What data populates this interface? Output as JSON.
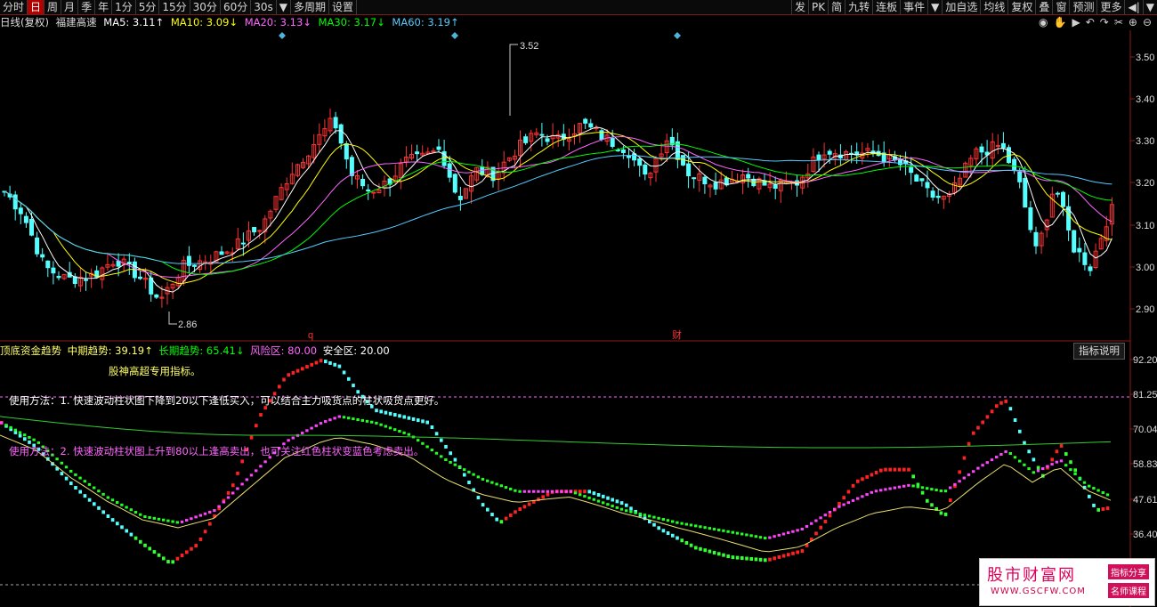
{
  "toolbar": {
    "left": [
      "分时",
      "日",
      "周",
      "月",
      "季",
      "年",
      "1分",
      "5分",
      "15分",
      "30分",
      "60分",
      "30s",
      "▼",
      "多周期",
      "设置"
    ],
    "active_index": 1,
    "right": [
      "发",
      "PK",
      "简",
      "九转",
      "连板",
      "事件",
      "▼",
      "加自选",
      "均线",
      "复权",
      "叠",
      "窗",
      "预测",
      "更多",
      "◀|",
      "▼"
    ]
  },
  "header": {
    "period": "日线(复权)",
    "stock": "福建高速",
    "ma5": "MA5: 3.11↑",
    "ma10": "MA10: 3.09↓",
    "ma20": "MA20: 3.13↓",
    "ma30": "MA30: 3.17↓",
    "ma60": "MA60: 3.19↑"
  },
  "colors": {
    "ma5": "#ffffff",
    "ma10": "#ffff00",
    "ma20": "#ff66ff",
    "ma30": "#00ff00",
    "ma60": "#55ccff",
    "up": "#ff3333",
    "down": "#55ffff"
  },
  "right_icons": [
    "eye-icon",
    "hand-icon",
    "play-icon",
    "undo-icon",
    "redo-icon",
    "scissors-icon",
    "plus-icon",
    "minus-icon"
  ],
  "price_axis": [
    "3.50",
    "3.40",
    "3.30",
    "3.20",
    "3.10",
    "3.00",
    "2.90"
  ],
  "price_annotations": {
    "high": "3.52",
    "low": "2.86"
  },
  "markers": {
    "q": "q",
    "cai": "财"
  },
  "indicator": {
    "name": "顶底资金趋势",
    "mid": "中期趋势: 39.19↑",
    "long": "长期趋势: 65.41↓",
    "risk": "风险区: 80.00",
    "safe": "安全区: 20.00",
    "explain_button": "指标说明",
    "note1": "股神高超专用指标。",
    "note2": "使用方法：1. 快速波动柱状图下降到20以下逢低买入，可以结合主力吸货点的柱状吸货点更好。",
    "note3": "使用方法：2. 快速波动柱状图上升到80以上逢高卖出，也可关注红色柱状变蓝色考虑卖出。"
  },
  "indicator_axis": [
    "92.20",
    "81.25",
    "70.04",
    "58.83",
    "47.61",
    "36.40"
  ],
  "watermark": {
    "title": "股市财富网",
    "url": "WWW.GSCFW.COM",
    "tag1": "指标分享",
    "tag2": "名师课程"
  }
}
